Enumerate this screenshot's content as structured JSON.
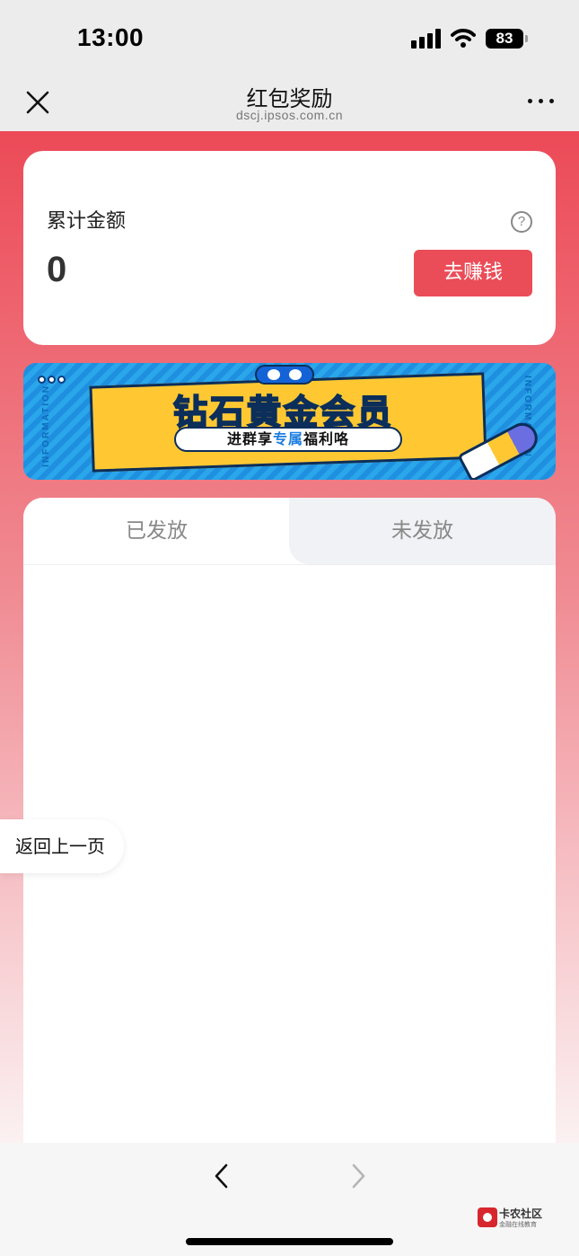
{
  "status_bar": {
    "time": "13:00",
    "battery": "83",
    "icons": [
      "signal-icon",
      "wifi-icon",
      "battery-icon"
    ]
  },
  "nav_bar": {
    "title": "红包奖励",
    "url": "dscj.ipsos.com.cn",
    "close_icon": "close-icon",
    "more_icon": "more-icon"
  },
  "summary": {
    "label": "累计金额",
    "amount": "0",
    "help_icon_text": "?",
    "earn_button": "去赚钱"
  },
  "banner": {
    "title": "钻石黄金会员",
    "subtitle_prefix": "进群享",
    "subtitle_highlight": "专属",
    "subtitle_suffix": "福利咯",
    "side_text_left": "INFORMATION",
    "side_text_right": "INFORMATION"
  },
  "tabs": [
    {
      "label": "已发放",
      "active": true
    },
    {
      "label": "未发放",
      "active": false
    }
  ],
  "floating": {
    "back_prev_label": "返回上一页"
  },
  "bottom_bar": {
    "back_icon": "chevron-left-icon",
    "forward_icon": "chevron-right-icon",
    "watermark_title": "卡农社区",
    "watermark_subtitle": "金融在线教育"
  },
  "colors": {
    "accent": "#ea4d58",
    "header_bg": "#ececec",
    "banner_yellow": "#ffc832",
    "banner_blue": "#2aa6ea"
  }
}
